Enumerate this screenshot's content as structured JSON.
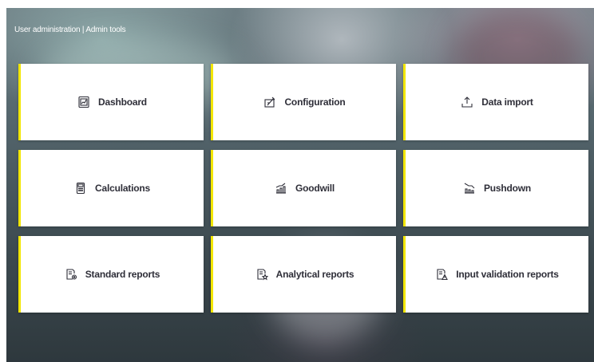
{
  "header": {
    "title": "User administration | Admin tools"
  },
  "tiles": [
    {
      "label": "Dashboard",
      "icon": "dashboard-icon"
    },
    {
      "label": "Configuration",
      "icon": "configuration-icon"
    },
    {
      "label": "Data import",
      "icon": "upload-icon"
    },
    {
      "label": "Calculations",
      "icon": "calculator-icon"
    },
    {
      "label": "Goodwill",
      "icon": "growth-chart-icon"
    },
    {
      "label": "Pushdown",
      "icon": "pushdown-icon"
    },
    {
      "label": "Standard reports",
      "icon": "report-settings-icon"
    },
    {
      "label": "Analytical reports",
      "icon": "report-star-icon"
    },
    {
      "label": "Input validation reports",
      "icon": "report-warning-icon"
    }
  ],
  "colors": {
    "accent": "#f2e600",
    "tile_text": "#2e2e38",
    "tile_bg": "#ffffff"
  }
}
